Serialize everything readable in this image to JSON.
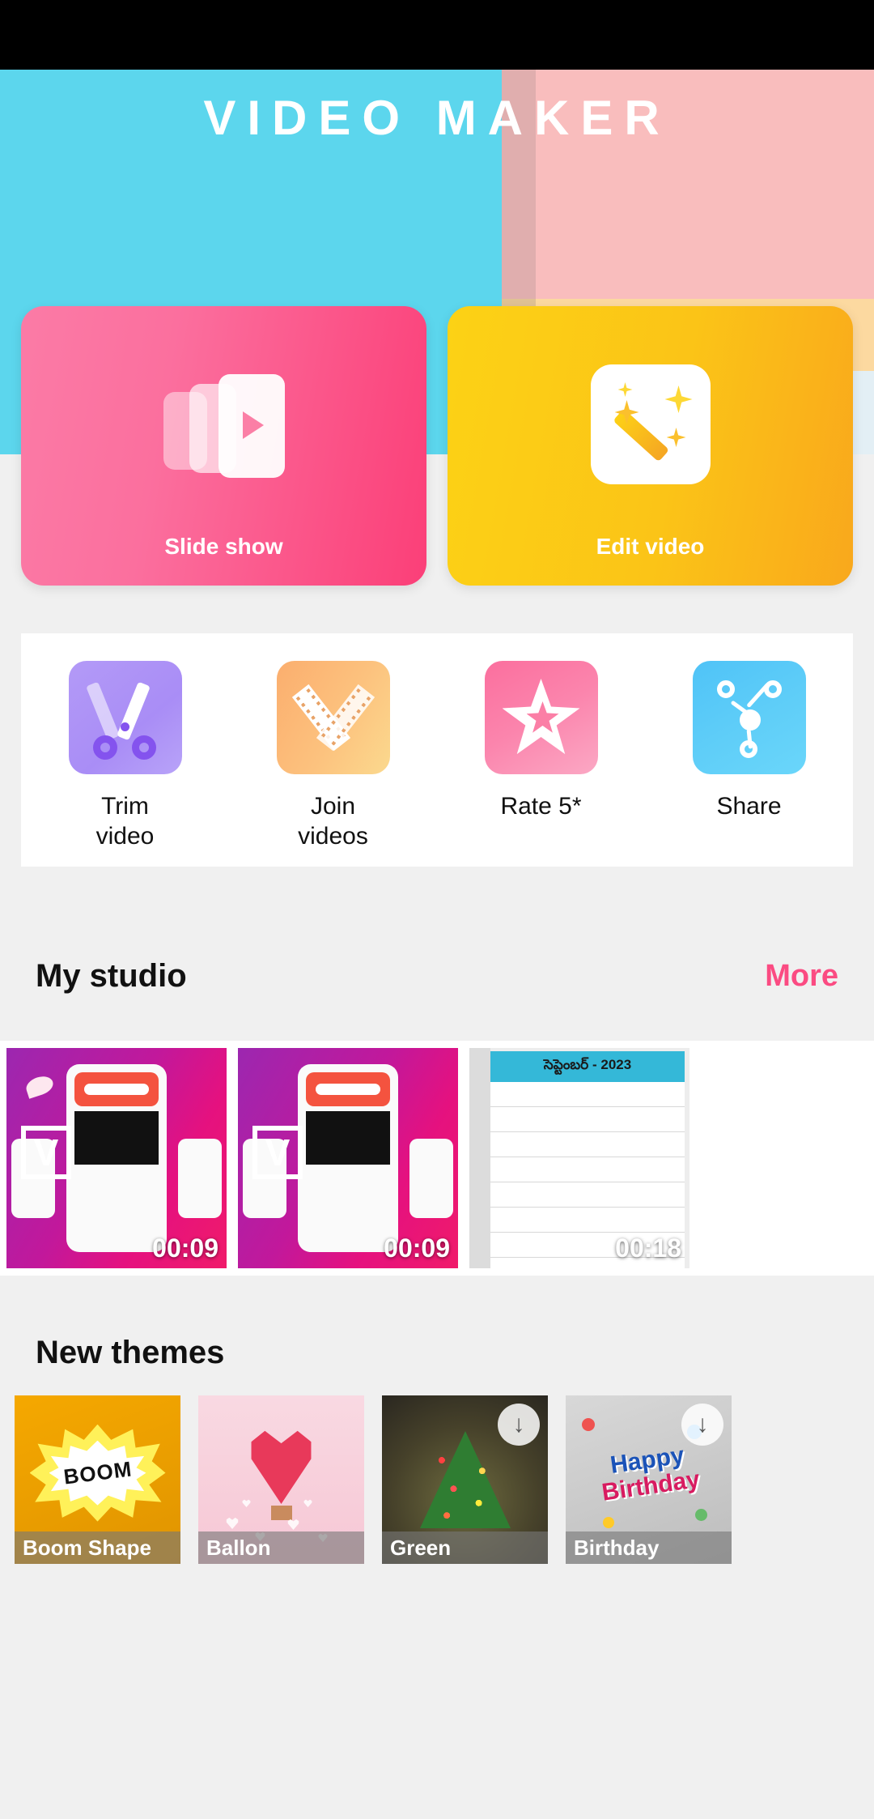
{
  "app": {
    "title": "VIDEO MAKER",
    "theme_colors": {
      "cyan": "#5cd6ed",
      "pink_block": "#f9bdbd",
      "cream_block": "#fcd9a0",
      "accent_pink": "#fb4b82",
      "accent_yellow": "#fcd215"
    }
  },
  "hero": {
    "cards": [
      {
        "label": "Slide show",
        "icon": "slideshow-icon",
        "color": "#fb5b90"
      },
      {
        "label": "Edit video",
        "icon": "magic-wand-icon",
        "color": "#fbc417"
      }
    ]
  },
  "quick_actions": [
    {
      "label": "Trim\nvideo",
      "line1": "Trim",
      "line2": "video",
      "icon": "scissors-icon",
      "color": "#ab8df6"
    },
    {
      "label": "Join\nvideos",
      "line1": "Join",
      "line2": "videos",
      "icon": "film-strips-icon",
      "color": "#fbc27e"
    },
    {
      "label": "Rate 5*",
      "line1": "Rate 5*",
      "line2": "",
      "icon": "star-icon",
      "color": "#fb7fa6"
    },
    {
      "label": "Share",
      "line1": "Share",
      "line2": "",
      "icon": "share-nodes-icon",
      "color": "#5ecdf8"
    }
  ],
  "studio": {
    "title": "My studio",
    "more_label": "More",
    "videos": [
      {
        "duration": "00:09",
        "type": "phone-promo",
        "letter": "V"
      },
      {
        "duration": "00:09",
        "type": "phone-promo",
        "letter": "V"
      },
      {
        "duration": "00:18",
        "type": "calendar",
        "calendar_title": "సెప్టెంబర్ - 2023"
      }
    ]
  },
  "themes": {
    "title": "New themes",
    "items": [
      {
        "name": "Boom Shape",
        "downloaded": true,
        "burst_text": "BOOM",
        "download_icon": ""
      },
      {
        "name": "Ballon",
        "downloaded": true,
        "burst_text": "",
        "download_icon": ""
      },
      {
        "name": "Green",
        "downloaded": false,
        "burst_text": "",
        "download_icon": "↓"
      },
      {
        "name": "Birthday",
        "downloaded": false,
        "burst_text": "",
        "download_icon": "↓",
        "art_line1": "Happy",
        "art_line2": "Birthday"
      }
    ]
  }
}
